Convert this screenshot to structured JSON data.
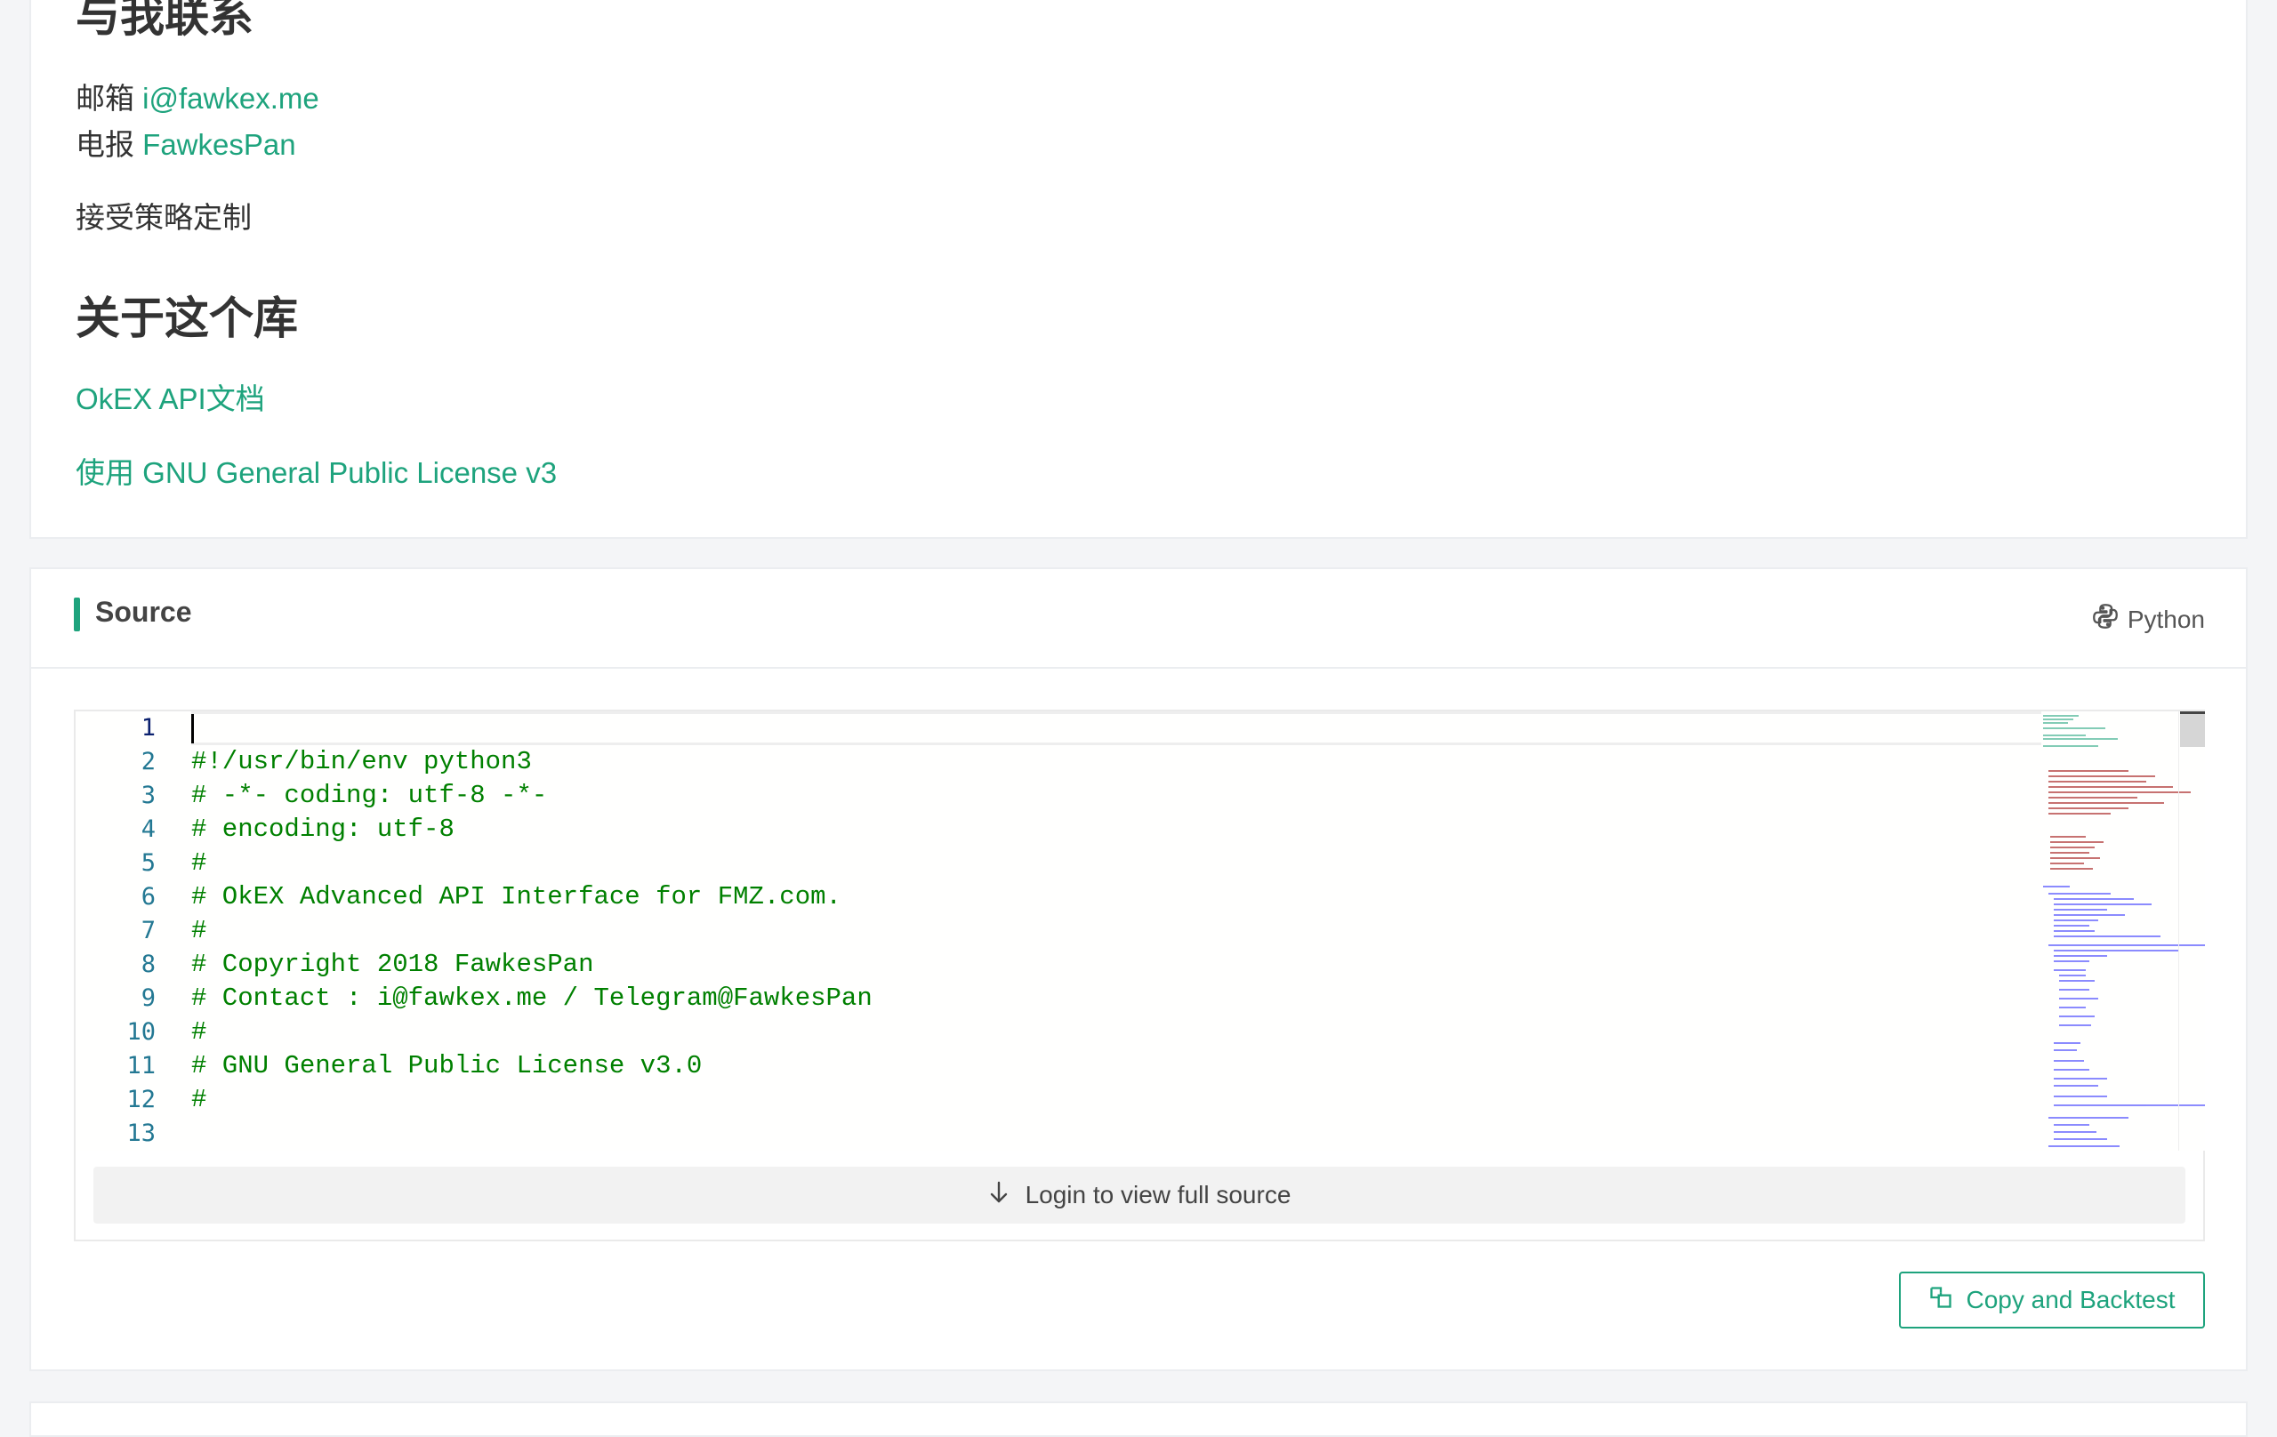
{
  "contact": {
    "heading": "与我联系",
    "email_label": "邮箱",
    "email_value": "i@fawkex.me",
    "telegram_label": "电报",
    "telegram_value": "FawkesPan",
    "note": "接受策略定制"
  },
  "about": {
    "heading": "关于这个库",
    "api_doc_link": "OkEX API文档",
    "license_link": "使用 GNU General Public License v3"
  },
  "source": {
    "title": "Source",
    "language": "Python",
    "line_numbers": [
      "1",
      "2",
      "3",
      "4",
      "5",
      "6",
      "7",
      "8",
      "9",
      "10",
      "11",
      "12",
      "13"
    ],
    "code_lines": [
      "",
      "#!/usr/bin/env python3",
      "# -*- coding: utf-8 -*-",
      "# encoding: utf-8",
      "#",
      "# OkEX Advanced API Interface for FMZ.com.",
      "#",
      "# Copyright 2018 FawkesPan",
      "# Contact : i@fawkex.me / Telegram@FawkesPan",
      "#",
      "# GNU General Public License v3.0",
      "#",
      ""
    ],
    "login_label": "Login to view full source",
    "copy_label": "Copy and Backtest"
  },
  "colors": {
    "accent": "#1ea37d",
    "comment": "#008000",
    "line_number": "#237893"
  },
  "icons": {
    "language": "python-icon",
    "login": "arrow-down-icon",
    "copy": "copy-icon"
  }
}
